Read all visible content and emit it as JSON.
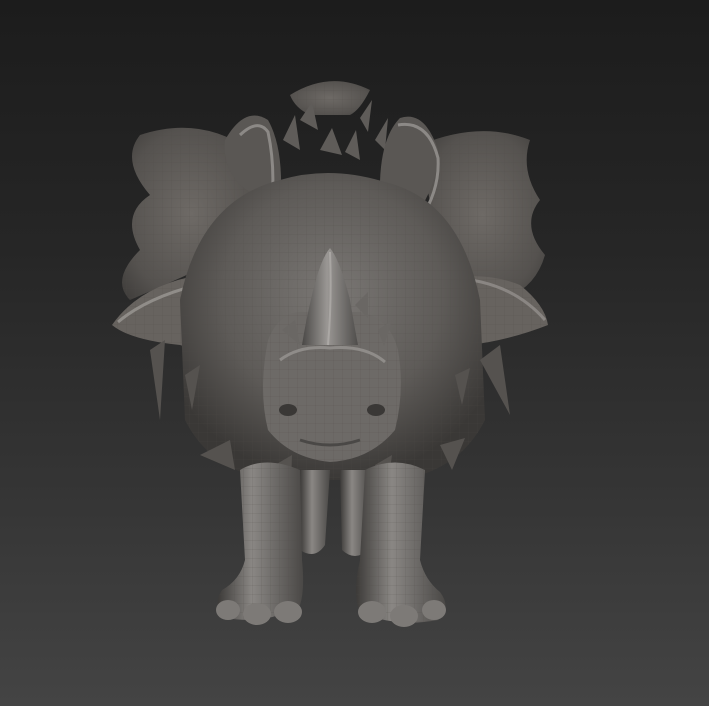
{
  "viewport": {
    "background_top": "#1c1c1c",
    "background_bottom": "#444444"
  },
  "model": {
    "material_color": "#6f6c69",
    "highlight_color": "#a9a6a3",
    "shadow_color": "#2b2a29",
    "parts": [
      "back-plate-top",
      "left-frill",
      "right-frill",
      "left-ear",
      "right-ear",
      "nose-horn",
      "head",
      "left-front-leg",
      "right-front-leg",
      "left-rear-leg",
      "right-rear-leg",
      "side-spikes"
    ]
  }
}
